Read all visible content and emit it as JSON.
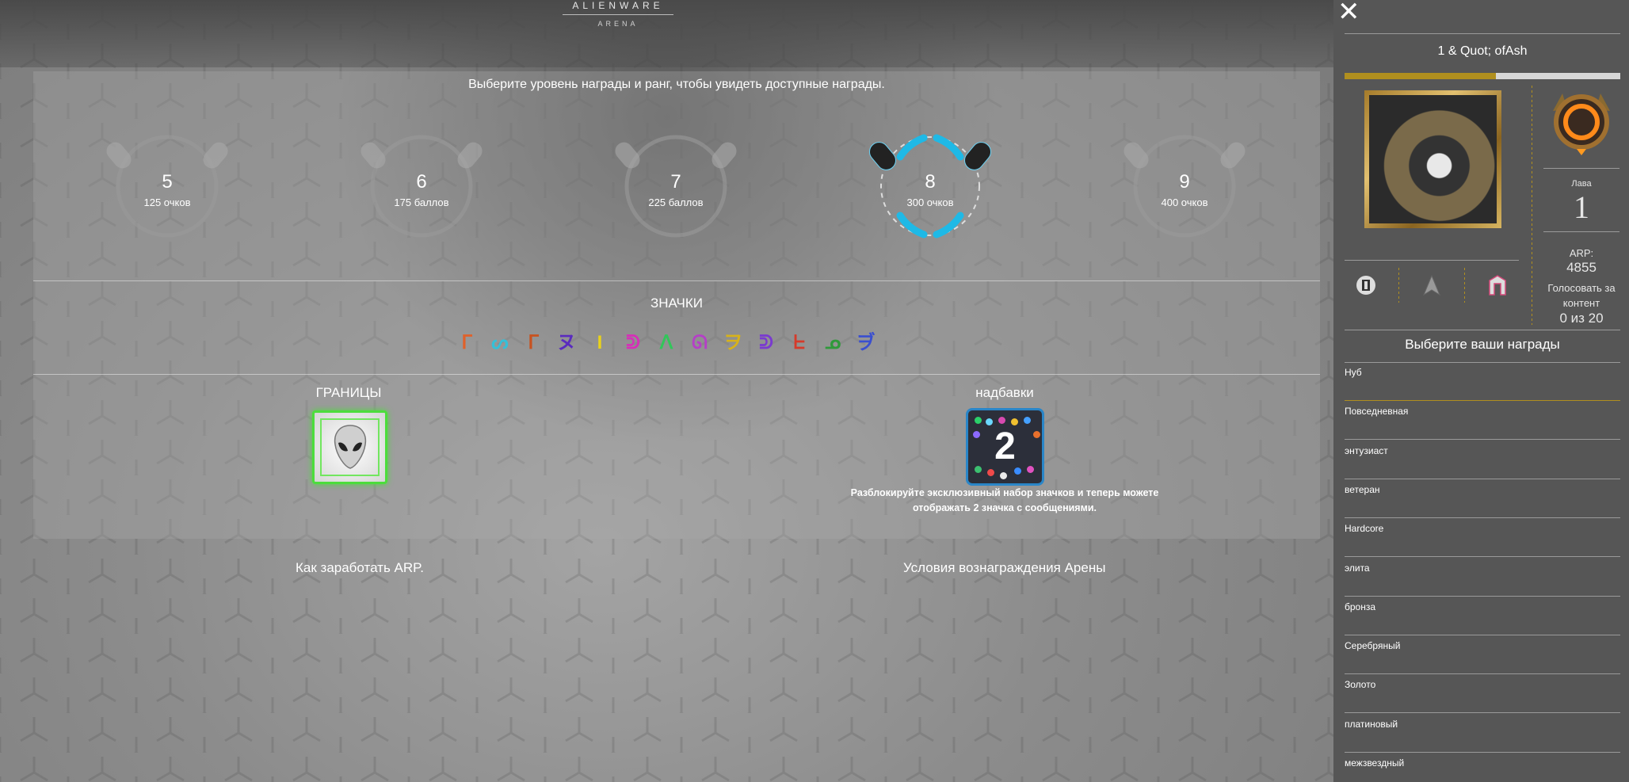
{
  "header": {
    "logo_main": "ALIENWARE",
    "logo_sub": "ARENA"
  },
  "subtitle": "Выберите уровень награды и ранг, чтобы увидеть доступные награды.",
  "levels": [
    {
      "num": "5",
      "points": "125 очков",
      "active": false
    },
    {
      "num": "6",
      "points": "175 баллов",
      "active": false
    },
    {
      "num": "7",
      "points": "225 баллов",
      "active": false
    },
    {
      "num": "8",
      "points": "300 очков",
      "active": true
    },
    {
      "num": "9",
      "points": "400 очков",
      "active": false
    }
  ],
  "badges": {
    "title": "ЗНАЧКИ",
    "items": [
      {
        "glyph": "ᒥ",
        "color": "#e0612a"
      },
      {
        "glyph": "ᔕ",
        "color": "#35c0d8"
      },
      {
        "glyph": "ᒥ",
        "color": "#c8521f"
      },
      {
        "glyph": "ヌ",
        "color": "#5a2bbf"
      },
      {
        "glyph": "I",
        "color": "#e9d21a"
      },
      {
        "glyph": "ᕲ",
        "color": "#d62fb8"
      },
      {
        "glyph": "ᐱ",
        "color": "#32c65a"
      },
      {
        "glyph": "ᘏ",
        "color": "#b53fc7"
      },
      {
        "glyph": "ヲ",
        "color": "#d7b21a"
      },
      {
        "glyph": "ᕲ",
        "color": "#7a3ad0"
      },
      {
        "glyph": "ᖶ",
        "color": "#d63a2a"
      },
      {
        "glyph": "ᓄ",
        "color": "#2f9a3a"
      },
      {
        "glyph": "ヺ",
        "color": "#3a4fd0"
      }
    ]
  },
  "borders": {
    "title": "ГРАНИЦЫ"
  },
  "perks": {
    "title": "надбавки",
    "number": "2",
    "description": "Разблокируйте эксклюзивный набор значков и теперь можете отображать 2 значка с сообщениями."
  },
  "links": {
    "earn_arp": "Как заработать ARP.",
    "terms": "Условия вознаграждения Арены"
  },
  "sidebar": {
    "close": "✕",
    "username": "1 & Quot; ofAsh",
    "progress_fraction": 0.55,
    "rank_label": "Лава",
    "rank_value": "1",
    "arp_label": "ARP:",
    "arp_value": "4855",
    "vote_label": "Голосовать за контент",
    "vote_value": "0 из 20",
    "choose_title": "Выберите ваши награды",
    "tiers": [
      "Нуб",
      "Повседневная",
      "энтузиаст",
      "ветеран",
      "Hardcore",
      "элита",
      "бронза",
      "Серебряный",
      "Золото",
      "платиновый",
      "межзвездный"
    ]
  },
  "colors": {
    "accent_gold": "#b08f1f",
    "active_level": "#1fb9e6",
    "border_green": "#4cdd3c",
    "perk_blue": "#2a86c8"
  }
}
